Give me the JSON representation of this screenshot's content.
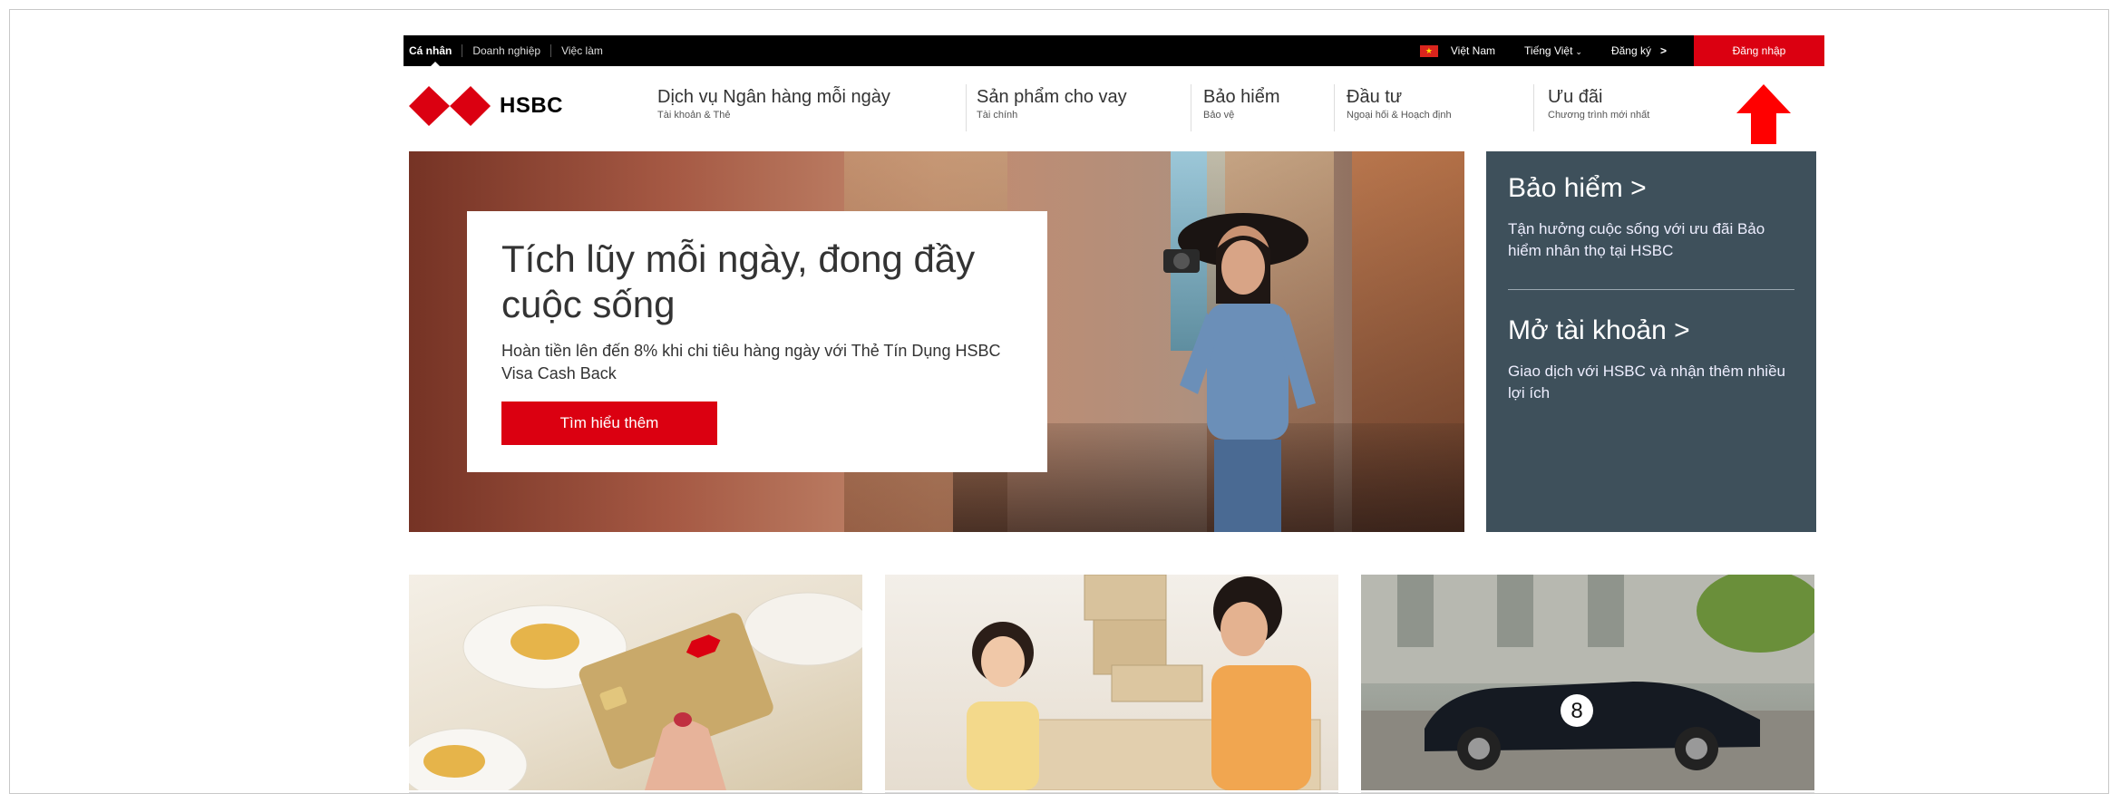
{
  "topbar": {
    "segments": [
      "Cá nhân",
      "Doanh nghiệp",
      "Việc làm"
    ],
    "country": "Việt Nam",
    "language": "Tiếng Việt",
    "register": "Đăng ký",
    "login": "Đăng nhập"
  },
  "brand": {
    "name": "HSBC",
    "color": "#db0011"
  },
  "nav": [
    {
      "title": "Dịch vụ Ngân hàng mỗi ngày",
      "sub": "Tài khoản & Thẻ"
    },
    {
      "title": "Sản phẩm cho vay",
      "sub": "Tài chính"
    },
    {
      "title": "Bảo hiểm",
      "sub": "Bảo vệ"
    },
    {
      "title": "Đầu tư",
      "sub": "Ngoại hối & Hoạch định"
    },
    {
      "title": "Ưu đãi",
      "sub": "Chương trình mới nhất"
    }
  ],
  "hero": {
    "title": "Tích lũy mỗi ngày, đong đầy cuộc sống",
    "desc": "Hoàn tiền lên đến 8% khi chi tiêu hàng ngày với Thẻ Tín Dụng HSBC Visa Cash Back",
    "button": "Tìm hiểu thêm"
  },
  "side": {
    "h1": "Bảo hiểm >",
    "p1": "Tận hưởng cuộc sống với ưu đãi Bảo hiểm nhân thọ tại HSBC",
    "h2": "Mở tài khoản >",
    "p2": "Giao dịch với HSBC và nhận thêm nhiều lợi ích"
  },
  "tiles": {
    "car_number": "8"
  },
  "colors": {
    "accent": "#db0011",
    "panel": "#3e505b",
    "topbar": "#000000"
  }
}
